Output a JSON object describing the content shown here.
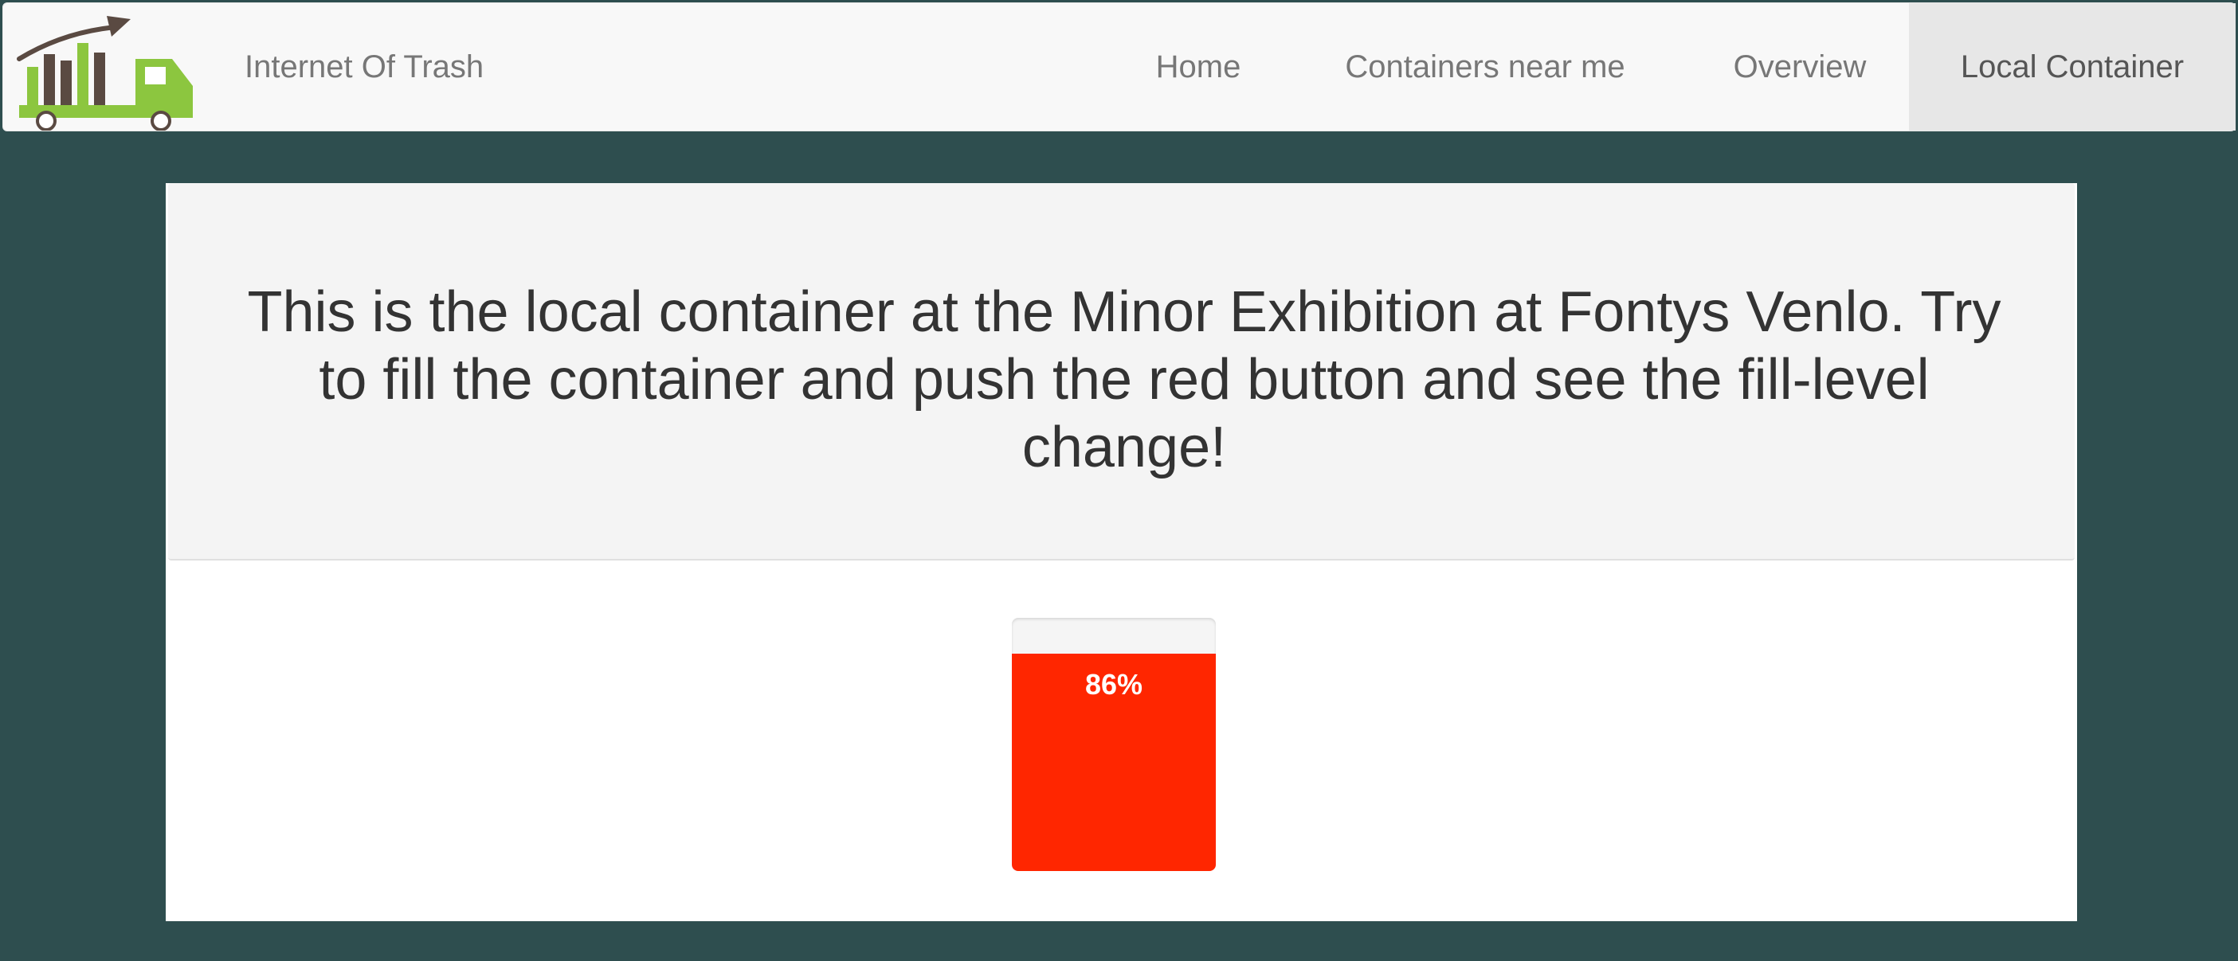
{
  "navbar": {
    "brand": "Internet Of Trash",
    "logo_icon": "trash-truck-chart-logo",
    "items": [
      {
        "label": "Home",
        "active": false
      },
      {
        "label": "Containers near me",
        "active": false
      },
      {
        "label": "Overview",
        "active": false
      },
      {
        "label": "Local Container",
        "active": true
      }
    ]
  },
  "main": {
    "headline": "This is the local container at the Minor Exhibition at Fontys Venlo. Try to fill the container and push the red button and see the fill-level change!",
    "container": {
      "fill_level": 0.86,
      "fill_label": "86%",
      "fill_color": "#ff2600"
    }
  },
  "colors": {
    "background": "#2e4e4f",
    "navbar": "#f8f8f8",
    "logo_green": "#8cc63f",
    "logo_brown": "#5a4a42"
  }
}
